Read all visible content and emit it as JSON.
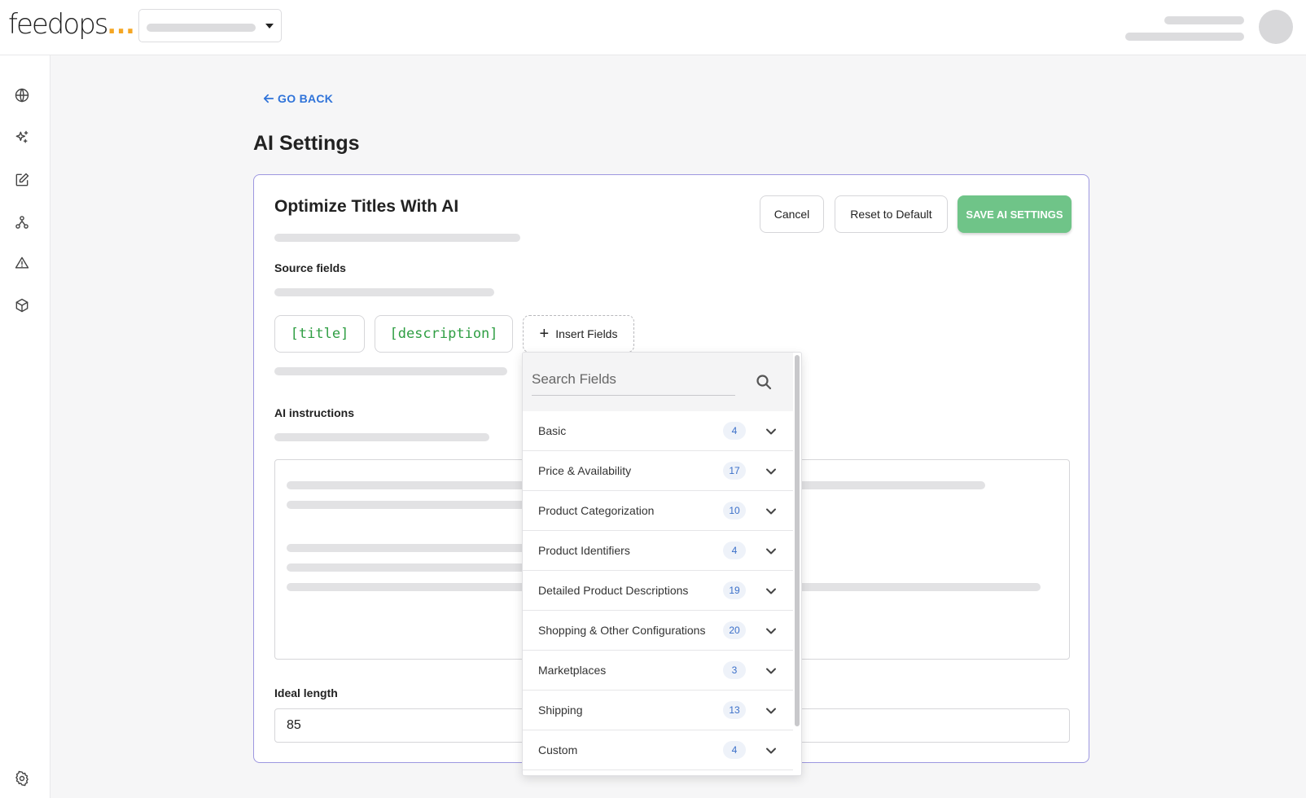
{
  "header": {
    "logo_text": "feedops",
    "logo_dots": "..."
  },
  "nav": {
    "back_label": "GO BACK",
    "page_title": "AI Settings"
  },
  "card": {
    "title": "Optimize Titles With AI",
    "buttons": {
      "cancel": "Cancel",
      "reset": "Reset to Default",
      "save": "SAVE AI SETTINGS"
    },
    "source_fields_label": "Source fields",
    "chips": [
      "[title]",
      "[description]"
    ],
    "insert_fields_label": "Insert Fields",
    "ai_instructions_label": "AI instructions",
    "ideal_length_label": "Ideal length",
    "ideal_length_value": "85"
  },
  "dropdown": {
    "search_placeholder": "Search Fields",
    "items": [
      {
        "name": "Basic",
        "count": "4"
      },
      {
        "name": "Price & Availability",
        "count": "17"
      },
      {
        "name": "Product Categorization",
        "count": "10"
      },
      {
        "name": "Product Identifiers",
        "count": "4"
      },
      {
        "name": "Detailed Product Descriptions",
        "count": "19"
      },
      {
        "name": "Shopping & Other Configurations",
        "count": "20"
      },
      {
        "name": "Marketplaces",
        "count": "3"
      },
      {
        "name": "Shipping",
        "count": "13"
      },
      {
        "name": "Custom",
        "count": "4"
      }
    ]
  },
  "colors": {
    "accent": "#2f73d9",
    "save_button": "#6fc488",
    "chip_text": "#2f9e43",
    "card_border": "#9d97e0",
    "logo_dots": "#f5a623"
  },
  "icons": [
    "globe-icon",
    "sparkle-icon",
    "edit-icon",
    "sitemap-icon",
    "warning-icon",
    "box-icon",
    "gear-icon",
    "search-icon",
    "chevron-down-icon",
    "arrow-left-icon",
    "plus-icon"
  ]
}
